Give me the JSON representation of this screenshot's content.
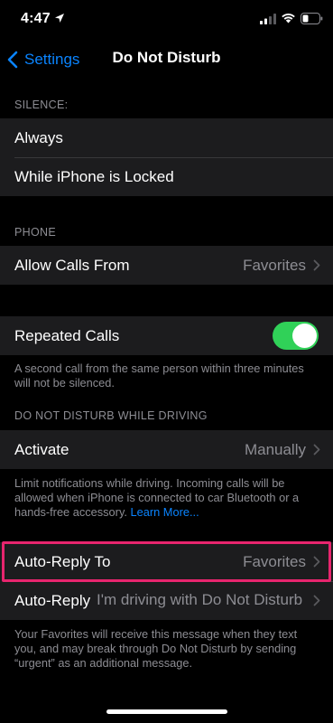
{
  "status_bar": {
    "time": "4:47"
  },
  "nav": {
    "back_label": "Settings",
    "title": "Do Not Disturb"
  },
  "silence": {
    "header": "SILENCE:",
    "items": [
      {
        "label": "Always"
      },
      {
        "label": "While iPhone is Locked"
      }
    ]
  },
  "phone": {
    "header": "PHONE",
    "allow_calls": {
      "label": "Allow Calls From",
      "value": "Favorites"
    }
  },
  "repeated_calls": {
    "label": "Repeated Calls",
    "enabled": true,
    "footer": "A second call from the same person within three minutes will not be silenced."
  },
  "driving": {
    "header": "DO NOT DISTURB WHILE DRIVING",
    "activate": {
      "label": "Activate",
      "value": "Manually"
    },
    "footer": "Limit notifications while driving. Incoming calls will be allowed when iPhone is connected to car Bluetooth or a hands-free accessory.",
    "learn_more": "Learn More..."
  },
  "auto_reply": {
    "to_label": "Auto-Reply To",
    "to_value": "Favorites",
    "label": "Auto-Reply",
    "message": "I'm driving with Do Not Disturb While Driving turned on.",
    "footer": "Your Favorites will receive this message when they text you, and may break through Do Not Disturb by sending “urgent” as an additional message."
  },
  "colors": {
    "accent": "#0a84ff",
    "toggle_on": "#30d158",
    "highlight": "#e8256e",
    "background": "#000000",
    "cell": "#1c1c1e"
  }
}
